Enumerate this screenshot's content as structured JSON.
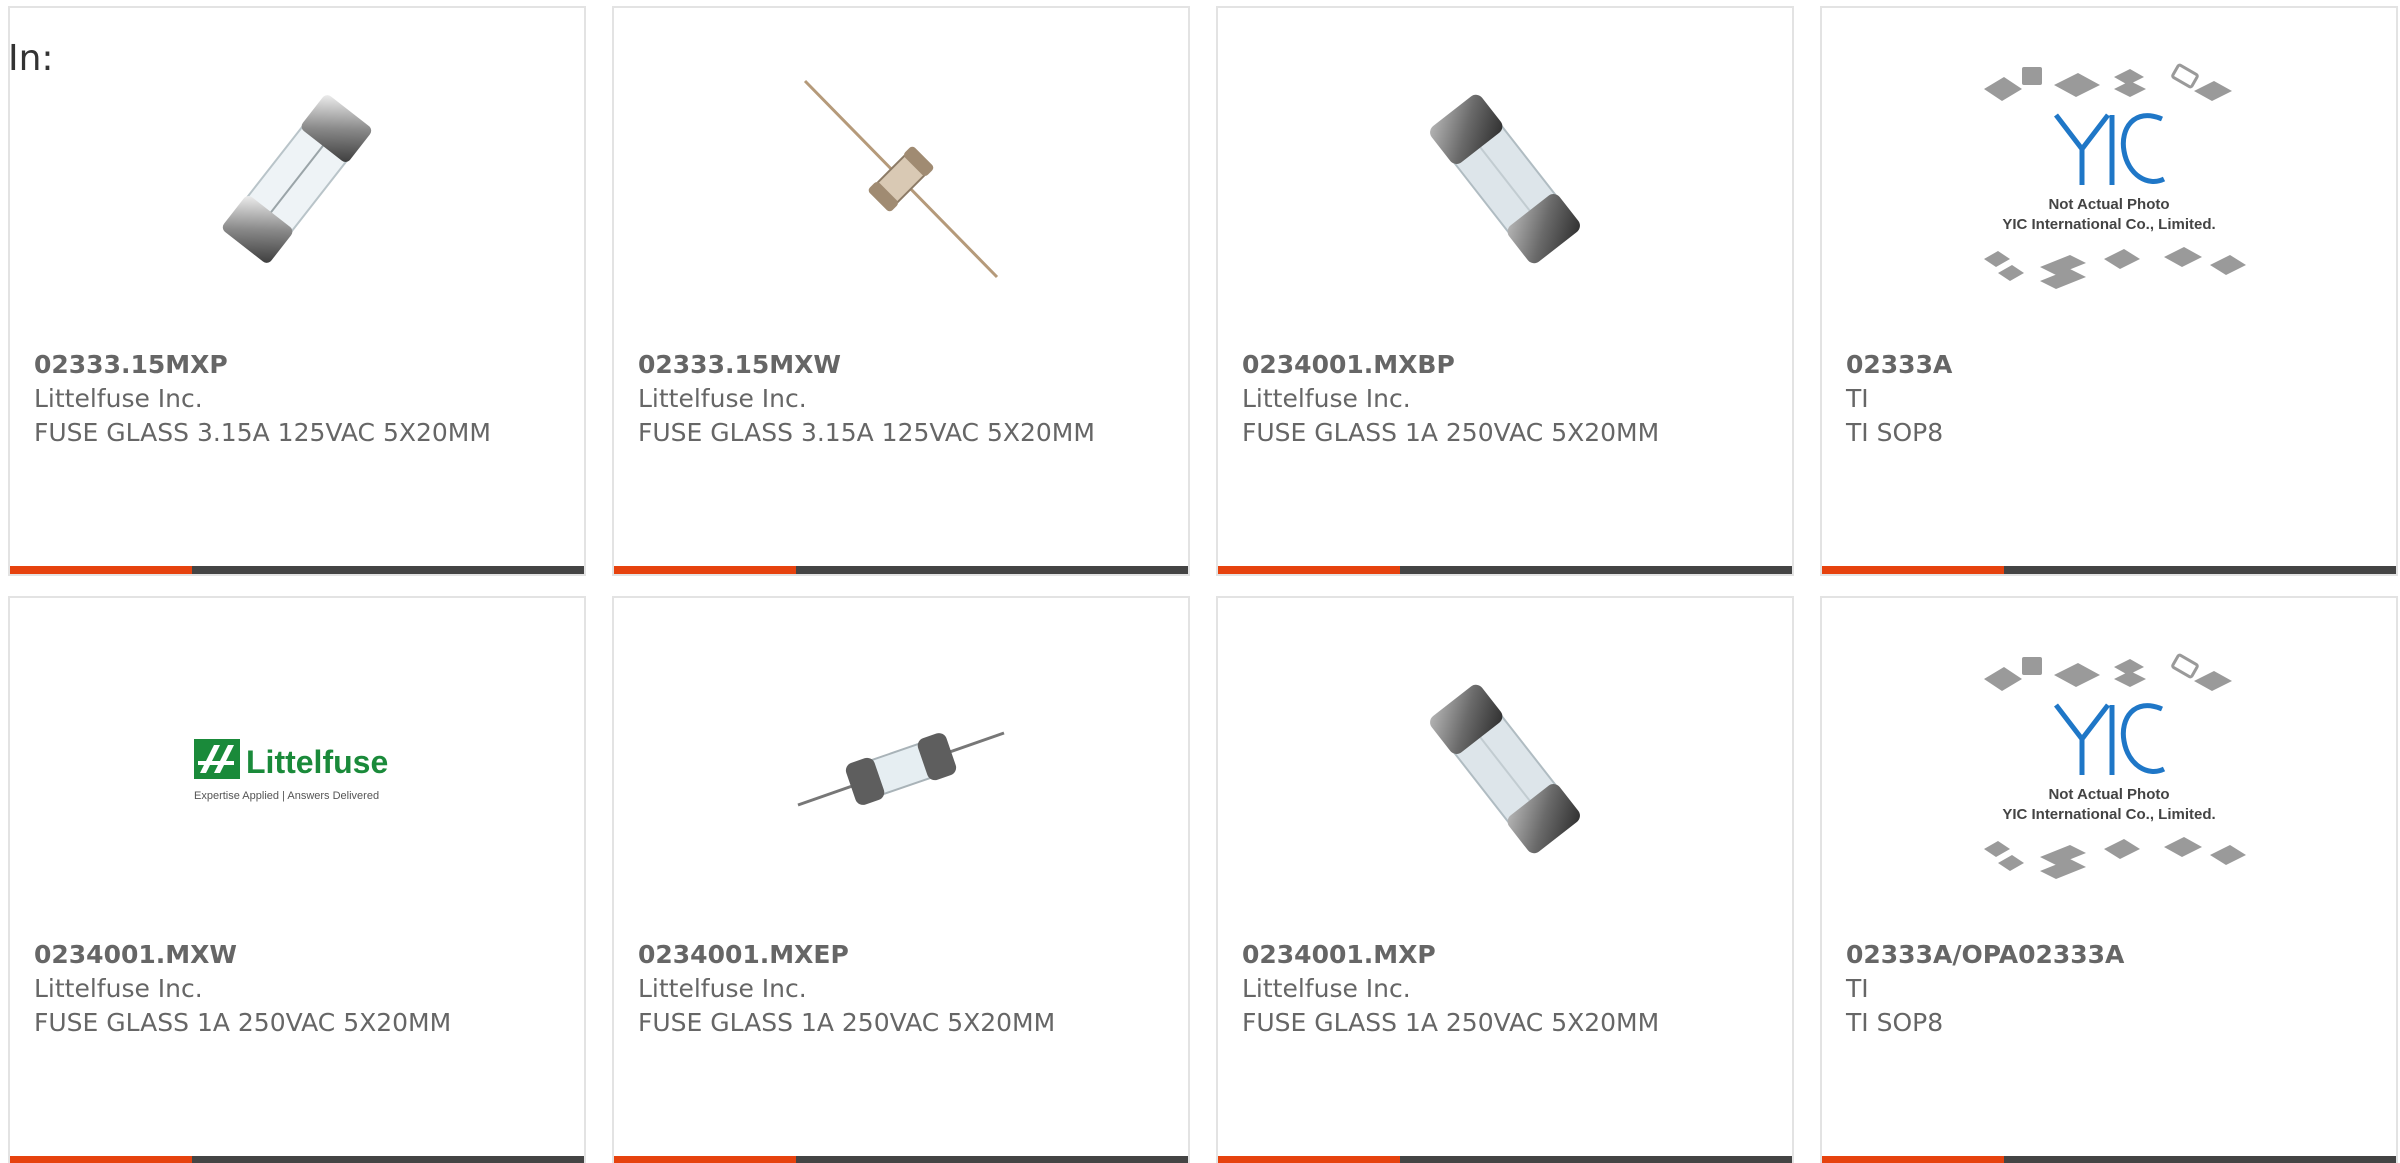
{
  "header": {
    "in_label": "In:"
  },
  "colors": {
    "accent": "#e6420e",
    "bar": "#444444",
    "text": "#666666",
    "border": "#e3e3e3",
    "logo_green": "#1a8a3a"
  },
  "placeholder": {
    "line1": "Not Actual Photo",
    "line2": "YIC International Co., Limited."
  },
  "logo": {
    "brand": "Littelfuse",
    "tagline": "Expertise Applied | Answers Delivered"
  },
  "products": [
    {
      "part_number": "02333.15MXP",
      "manufacturer": "Littelfuse Inc.",
      "description": "FUSE GLASS 3.15A 125VAC 5X20MM",
      "image": "glass-fuse-clear"
    },
    {
      "part_number": "02333.15MXW",
      "manufacturer": "Littelfuse Inc.",
      "description": "FUSE GLASS 3.15A 125VAC 5X20MM",
      "image": "axial-fuse-small"
    },
    {
      "part_number": "0234001.MXBP",
      "manufacturer": "Littelfuse Inc.",
      "description": "FUSE GLASS 1A 250VAC 5X20MM",
      "image": "glass-fuse-dark"
    },
    {
      "part_number": "02333A",
      "manufacturer": "TI",
      "description": "TI SOP8",
      "image": "yic-placeholder"
    },
    {
      "part_number": "0234001.MXW",
      "manufacturer": "Littelfuse Inc.",
      "description": "FUSE GLASS 1A 250VAC 5X20MM",
      "image": "littelfuse-logo"
    },
    {
      "part_number": "0234001.MXEP",
      "manufacturer": "Littelfuse Inc.",
      "description": "FUSE GLASS 1A 250VAC 5X20MM",
      "image": "axial-fuse-leads"
    },
    {
      "part_number": "0234001.MXP",
      "manufacturer": "Littelfuse Inc.",
      "description": "FUSE GLASS 1A 250VAC 5X20MM",
      "image": "glass-fuse-dark"
    },
    {
      "part_number": "02333A/OPA02333A",
      "manufacturer": "TI",
      "description": "TI SOP8",
      "image": "yic-placeholder"
    }
  ]
}
